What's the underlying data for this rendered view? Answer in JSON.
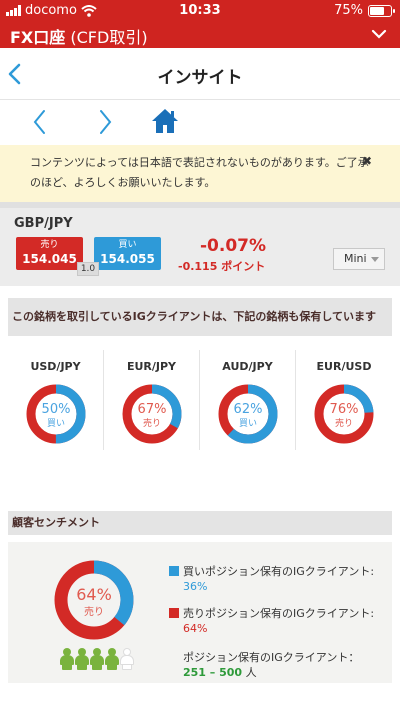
{
  "status_bar": {
    "carrier": "docomo",
    "time": "10:33",
    "battery_pct": "75%",
    "battery_level": 0.75
  },
  "app_header": {
    "title_main": "FX口座",
    "title_sub": "(CFD取引)"
  },
  "nav": {
    "page_title": "インサイト"
  },
  "notice": {
    "text": "コンテンツによっては日本語で表記されないものがあります。ご了承のほど、よろしくお願いいたします。",
    "close_symbol": "✖"
  },
  "ticker": {
    "symbol": "GBP/JPY",
    "sell_label": "売り",
    "sell_price": "154.045",
    "buy_label": "買い",
    "buy_price": "154.055",
    "spread": "1.0",
    "change_pct": "-0.07%",
    "change_points": "-0.115 ポイント",
    "size_option": "Mini"
  },
  "related_section": {
    "heading": "この銘柄を取引しているIGクライアントは、下記の銘柄も保有しています",
    "items": [
      {
        "name": "USD/JPY",
        "pct": "50%",
        "side": "買い",
        "buy_share": 0.5,
        "dominant": "buy"
      },
      {
        "name": "EUR/JPY",
        "pct": "67%",
        "side": "売り",
        "buy_share": 0.33,
        "dominant": "sell"
      },
      {
        "name": "AUD/JPY",
        "pct": "62%",
        "side": "買い",
        "buy_share": 0.62,
        "dominant": "buy"
      },
      {
        "name": "EUR/USD",
        "pct": "76%",
        "side": "売り",
        "buy_share": 0.24,
        "dominant": "sell"
      }
    ]
  },
  "sentiment_section": {
    "heading": "顧客センチメント",
    "pct": "64%",
    "side": "売り",
    "buy_share": 0.36,
    "buy_legend": "買いポジション保有のIGクライアント:",
    "buy_value": "36%",
    "sell_legend": "売りポジション保有のIGクライアント:",
    "sell_value": "64%",
    "clients_label": "ポジション保有のIGクライアント：",
    "clients_range": "251 – 500",
    "clients_unit": "人",
    "people_filled": 4,
    "people_total": 5
  },
  "colors": {
    "brand_red": "#cf2420",
    "sell_red": "#d32a26",
    "buy_blue": "#2e9ad8",
    "sell_text": "#e05a4f",
    "buy_text": "#4aa3e0",
    "people_green": "#7ab33e"
  }
}
